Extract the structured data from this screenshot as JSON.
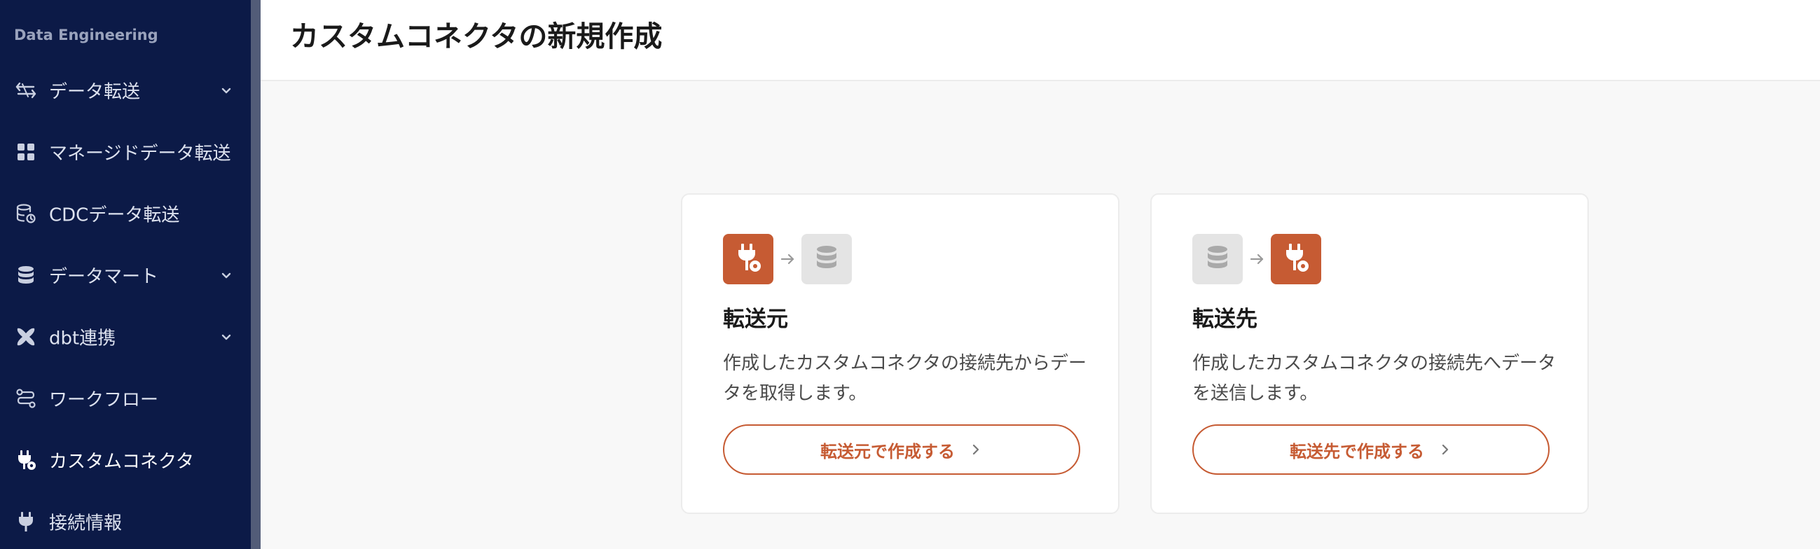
{
  "sidebar": {
    "section_title": "Data Engineering",
    "items": [
      {
        "label": "データ転送",
        "icon": "transfer-arrows-icon",
        "expandable": true
      },
      {
        "label": "マネージドデータ転送",
        "icon": "grid-icon",
        "expandable": false
      },
      {
        "label": "CDCデータ転送",
        "icon": "database-sync-icon",
        "expandable": false
      },
      {
        "label": "データマート",
        "icon": "database-icon",
        "expandable": true
      },
      {
        "label": "dbt連携",
        "icon": "dbt-icon",
        "expandable": true
      },
      {
        "label": "ワークフロー",
        "icon": "workflow-icon",
        "expandable": false
      },
      {
        "label": "カスタムコネクタ",
        "icon": "plug-gear-icon",
        "expandable": false,
        "active": true
      },
      {
        "label": "接続情報",
        "icon": "plug-icon",
        "expandable": false
      }
    ]
  },
  "header": {
    "title": "カスタムコネクタの新規作成"
  },
  "cards": {
    "source": {
      "title": "転送元",
      "description": "作成したカスタムコネクタの接続先からデータを取得します。",
      "button_label": "転送元で作成する",
      "flow_icons": [
        "plug-gear-icon",
        "arrow-right-icon",
        "database-icon"
      ]
    },
    "destination": {
      "title": "転送先",
      "description": "作成したカスタムコネクタの接続先へデータを送信します。",
      "button_label": "転送先で作成する",
      "flow_icons": [
        "database-icon",
        "arrow-right-icon",
        "plug-gear-icon"
      ]
    }
  },
  "colors": {
    "sidebar_bg": "#0c1a47",
    "accent": "#c65b33",
    "page_bg": "#f8f8f8"
  }
}
